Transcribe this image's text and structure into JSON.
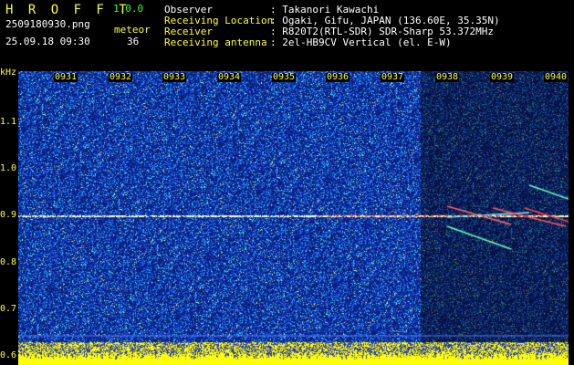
{
  "app": {
    "title": "H R O F F T",
    "version": "1.0.0",
    "filename": "2509180930.png",
    "datetime": "25.09.18 09:30",
    "meteor_label": "meteor",
    "meteor_count": "36"
  },
  "info": {
    "rows": [
      {
        "label": "Observer",
        "value": ": Takanori Kawachi"
      },
      {
        "label": "Receiving Location",
        "value": ": Ogaki, Gifu, JAPAN (136.60E, 35.35N)"
      },
      {
        "label": "Receiver",
        "value": ": R820T2(RTL-SDR) SDR-Sharp 53.372MHz"
      },
      {
        "label": "Receiving antenna",
        "value": ": 2el-HB9CV Vertical (el. E-W)"
      }
    ]
  },
  "axis": {
    "y_unit": "kHz",
    "y_ticks": [
      "1.1",
      "1.0",
      "0.9",
      "0.8",
      "0.7",
      "0.6"
    ],
    "y_values": [
      1.1,
      1.0,
      0.9,
      0.8,
      0.7,
      0.6
    ],
    "y_range": [
      0.58,
      1.21
    ],
    "x_ticks": [
      "0931",
      "0932",
      "0933",
      "0934",
      "0935",
      "0936",
      "0937",
      "0938",
      "0939",
      "0940"
    ]
  },
  "colors": {
    "text_primary": "#ffff33",
    "text_accent": "#33ff33",
    "text_white": "#ffffff",
    "background": "#000000",
    "carrier": "#ff3333",
    "signal_bar": "#ffff00"
  }
}
